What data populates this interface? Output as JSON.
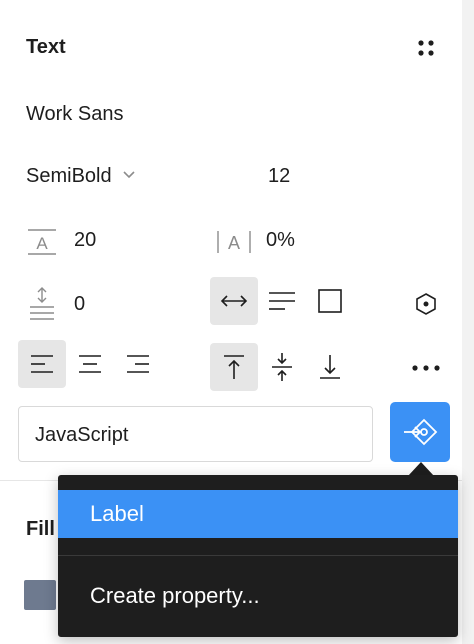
{
  "section": {
    "title": "Text"
  },
  "font": {
    "family": "Work Sans",
    "weight": "SemiBold",
    "size": "12",
    "line_height": "20",
    "letter_spacing": "0%",
    "paragraph_spacing": "0"
  },
  "property_input": {
    "value": "JavaScript"
  },
  "fill": {
    "title": "Fill"
  },
  "dropdown": {
    "items": [
      {
        "label": "Label"
      },
      {
        "label": "Create property..."
      }
    ]
  }
}
